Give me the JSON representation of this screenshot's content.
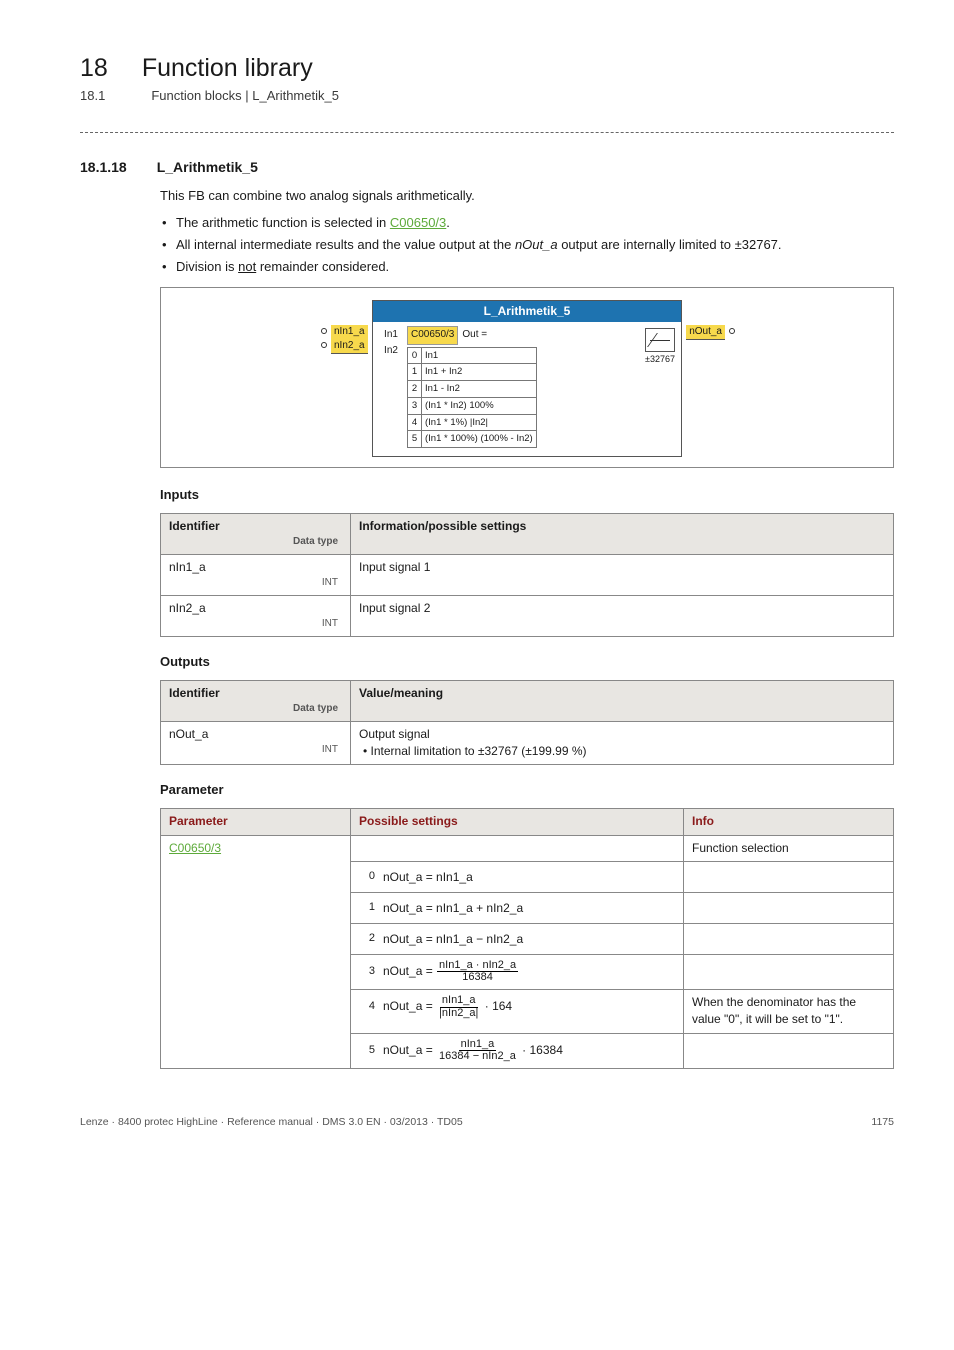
{
  "header": {
    "chapter_num": "18",
    "chapter_title": "Function library",
    "sub_num": "18.1",
    "sub_title": "Function blocks | L_Arithmetik_5"
  },
  "section": {
    "num": "18.1.18",
    "title": "L_Arithmetik_5",
    "intro": "This FB can combine two analog signals arithmetically.",
    "bullet1_pre": "The arithmetic function is selected in ",
    "bullet1_link": "C00650/3",
    "bullet1_post": ".",
    "bullet2_pre": "All internal intermediate results and the value output at the ",
    "bullet2_ital": "nOut_a",
    "bullet2_post": " output are internally limited to ±32767.",
    "bullet3_pre": "Division is ",
    "bullet3_under": "not",
    "bullet3_post": " remainder considered."
  },
  "diagram": {
    "title": "L_Arithmetik_5",
    "in1_port": "nIn1_a",
    "in2_port": "nIn2_a",
    "in1_label": "In1",
    "in2_label": "In2",
    "code": "C00650/3",
    "out_eq": "Out =",
    "limit_label": "±32767",
    "out_port": "nOut_a",
    "opts": [
      {
        "idx": "0",
        "txt": "In1"
      },
      {
        "idx": "1",
        "txt": "In1 + In2"
      },
      {
        "idx": "2",
        "txt": "In1 - In2"
      },
      {
        "idx": "3",
        "txt": "(In1 * In2) 100%"
      },
      {
        "idx": "4",
        "txt": "(In1 * 1%) |In2|"
      },
      {
        "idx": "5",
        "txt": "(In1 * 100%) (100% - In2)"
      }
    ]
  },
  "inputs": {
    "heading": "Inputs",
    "h_identifier": "Identifier",
    "h_info": "Information/possible settings",
    "dtype_label": "Data type",
    "rows": [
      {
        "id": "nIn1_a",
        "dtype": "INT",
        "info": "Input signal 1"
      },
      {
        "id": "nIn2_a",
        "dtype": "INT",
        "info": "Input signal 2"
      }
    ]
  },
  "outputs": {
    "heading": "Outputs",
    "h_identifier": "Identifier",
    "h_value": "Value/meaning",
    "dtype_label": "Data type",
    "rows": [
      {
        "id": "nOut_a",
        "dtype": "INT",
        "line1": "Output signal",
        "line2": "• Internal limitation to ±32767 (±199.99 %)"
      }
    ]
  },
  "params": {
    "heading": "Parameter",
    "h_param": "Parameter",
    "h_possible": "Possible settings",
    "h_info": "Info",
    "code_link": "C00650/3",
    "func_sel": "Function selection",
    "rows": [
      {
        "idx": "0",
        "lhs": "nOut_a = nIn1_a",
        "info": ""
      },
      {
        "idx": "1",
        "lhs": "nOut_a = nIn1_a + nIn2_a",
        "info": ""
      },
      {
        "idx": "2",
        "lhs": "nOut_a = nIn1_a − nIn2_a",
        "info": ""
      },
      {
        "idx": "3",
        "lhs_pre": "nOut_a = ",
        "num": "nIn1_a · nIn2_a",
        "den": "16384",
        "info": ""
      },
      {
        "idx": "4",
        "lhs_pre": "nOut_a = ",
        "num": "nIn1_a",
        "den": "|nIn2_a|",
        "suffix": " · 164",
        "info": "When the denominator has the value \"0\", it will be set to \"1\"."
      },
      {
        "idx": "5",
        "lhs_pre": "nOut_a = ",
        "num": "nIn1_a",
        "den": "16384 − nIn2_a",
        "suffix": " · 16384",
        "info": ""
      }
    ]
  },
  "footer": {
    "left": "Lenze · 8400 protec HighLine · Reference manual · DMS 3.0 EN · 03/2013 · TD05",
    "right": "1175"
  }
}
